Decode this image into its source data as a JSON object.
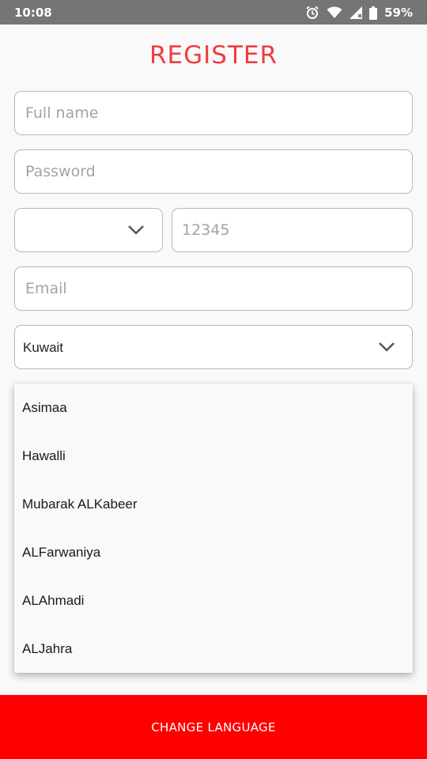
{
  "status_bar": {
    "time": "10:08",
    "battery_percent": "59%",
    "icons": [
      "alarm-icon",
      "wifi-icon",
      "signal-icon",
      "battery-icon"
    ]
  },
  "form": {
    "title": "REGISTER",
    "full_name": {
      "placeholder": "Full name",
      "value": ""
    },
    "password": {
      "placeholder": "Password",
      "value": ""
    },
    "country_code": {
      "value": "",
      "icon": "chevron-down-icon"
    },
    "phone": {
      "placeholder": "12345",
      "value": ""
    },
    "email": {
      "placeholder": "Email",
      "value": ""
    },
    "country": {
      "value": "Kuwait",
      "icon": "chevron-down-icon"
    }
  },
  "dropdown": {
    "options": [
      "Asimaa",
      "Hawalli",
      "Mubarak ALKabeer",
      "ALFarwaniya",
      "ALAhmadi",
      "ALJahra"
    ]
  },
  "footer": {
    "change_language_label": "CHANGE LANGUAGE"
  },
  "colors": {
    "accent": "#ee3d3d",
    "footer_bg": "#ff0000",
    "status_bar_bg": "#757575",
    "field_border": "#b8b8b8"
  }
}
